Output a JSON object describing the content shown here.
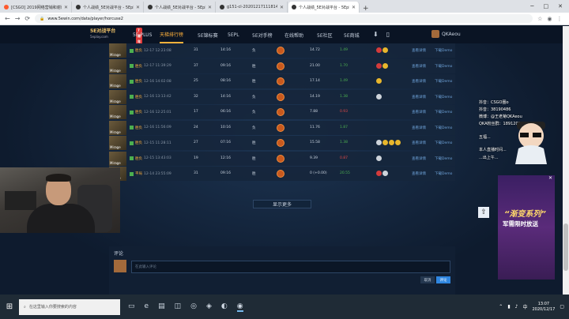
{
  "browser": {
    "tabs": [
      {
        "title": "[CSGO] 2019网络营销和谢谢...",
        "active": false
      },
      {
        "title": "个人战绩_5E对战平台 - 5Eplay完...",
        "active": false
      },
      {
        "title": "个人战绩_5E对战平台 - 5Eplay完...",
        "active": false
      },
      {
        "title": "g151-cl-20201217111814024...",
        "active": false
      },
      {
        "title": "个人战绩_5E对战平台 - 5Eplay完...",
        "active": true
      }
    ],
    "url": "www.5ewin.com/data/player/horcuse2",
    "newtab": "+",
    "win_min": "─",
    "win_max": "□",
    "win_close": "✕"
  },
  "site": {
    "logo": "5E对战平台",
    "logo_sub": "5eplay.com",
    "badge": "7周年",
    "nav": [
      {
        "label": "5E PLUS",
        "active": false
      },
      {
        "label": "天梯排行榜",
        "active": true
      },
      {
        "label": "5E锦标赛",
        "active": false
      },
      {
        "label": "5EPL",
        "active": false
      },
      {
        "label": "5E对手榜",
        "active": false
      },
      {
        "label": "在线帮助",
        "active": false
      },
      {
        "label": "5E社区",
        "active": false
      },
      {
        "label": "5E商城",
        "active": false
      }
    ],
    "username": "QKAeou"
  },
  "matches": [
    {
      "map": "Mirage",
      "result": "胜负",
      "time": "12-17 12:23:08",
      "rank": "31",
      "duration": "14:16",
      "mode": "负",
      "rating": "14.72",
      "kd": "1.49",
      "kd_pos": true,
      "medals": [
        "red",
        "gold"
      ]
    },
    {
      "map": "Mirage",
      "result": "胜负",
      "time": "12-17 11:39:29",
      "rank": "37",
      "duration": "09:16",
      "mode": "胜",
      "rating": "21.00",
      "kd": "1.70",
      "kd_pos": true,
      "medals": [
        "red",
        "gold"
      ]
    },
    {
      "map": "Mirage",
      "result": "胜负",
      "time": "12-16 14:02:08",
      "rank": "25",
      "duration": "08:16",
      "mode": "胜",
      "rating": "17.14",
      "kd": "1.49",
      "kd_pos": true,
      "medals": [
        "gold"
      ]
    },
    {
      "map": "Mirage",
      "result": "胜负",
      "time": "12-16 13:13:42",
      "rank": "32",
      "duration": "14:16",
      "mode": "负",
      "rating": "14.19",
      "kd": "1.38",
      "kd_pos": true,
      "medals": [
        "skull"
      ]
    },
    {
      "map": "Mirage",
      "result": "胜负",
      "time": "12-16 12:25:01",
      "rank": "17",
      "duration": "06:16",
      "mode": "负",
      "rating": "7.88",
      "kd": "0.93",
      "kd_pos": false,
      "medals": []
    },
    {
      "map": "Mirage",
      "result": "胜负",
      "time": "12-16 11:56:09",
      "rank": "24",
      "duration": "10:16",
      "mode": "负",
      "rating": "11.76",
      "kd": "1.87",
      "kd_pos": true,
      "medals": []
    },
    {
      "map": "Mirage",
      "result": "胜负",
      "time": "12-15 11:28:11",
      "rank": "27",
      "duration": "07:16",
      "mode": "胜",
      "rating": "15.58",
      "kd": "1.38",
      "kd_pos": true,
      "medals": [
        "skull",
        "gold",
        "gold",
        "gold"
      ]
    },
    {
      "map": "Mirage",
      "result": "胜负",
      "time": "12-15 13:43:03",
      "rank": "19",
      "duration": "12:16",
      "mode": "胜",
      "rating": "9.39",
      "kd": "0.87",
      "kd_pos": false,
      "medals": [
        "skull"
      ]
    },
    {
      "map": "Mirage",
      "result": "平局",
      "time": "12-14 23:55:09",
      "rank": "31",
      "duration": "09:16",
      "mode": "胜",
      "rating": "0 (+0.00)",
      "kd": "20.55",
      "kd2": "1.49",
      "kd_pos": true,
      "medals": [
        "red",
        "skull"
      ]
    }
  ],
  "row_actions": {
    "view": "查看详情",
    "download": "下载Demo"
  },
  "more_button": "显示更多",
  "comment": {
    "title": "评论",
    "placeholder": "在此输入评论",
    "cancel": "取消",
    "submit": "评论"
  },
  "streamer_overlay": {
    "lines": [
      "抖音：CSGO圈o",
      "抖音：38190486",
      "微博：@王老菊QKAeou",
      "QKA粉丝群：1891203...",
      "五福...",
      "本人直播时间...",
      "...出上午..."
    ]
  },
  "ad": {
    "title": "“渐变系列”",
    "subtitle": "军需限时放送",
    "close": "✕"
  },
  "taskbar": {
    "search_placeholder": "在这里输入你要搜索的内容",
    "time": "13:07",
    "date": "2020/12/17",
    "lang": "中"
  }
}
